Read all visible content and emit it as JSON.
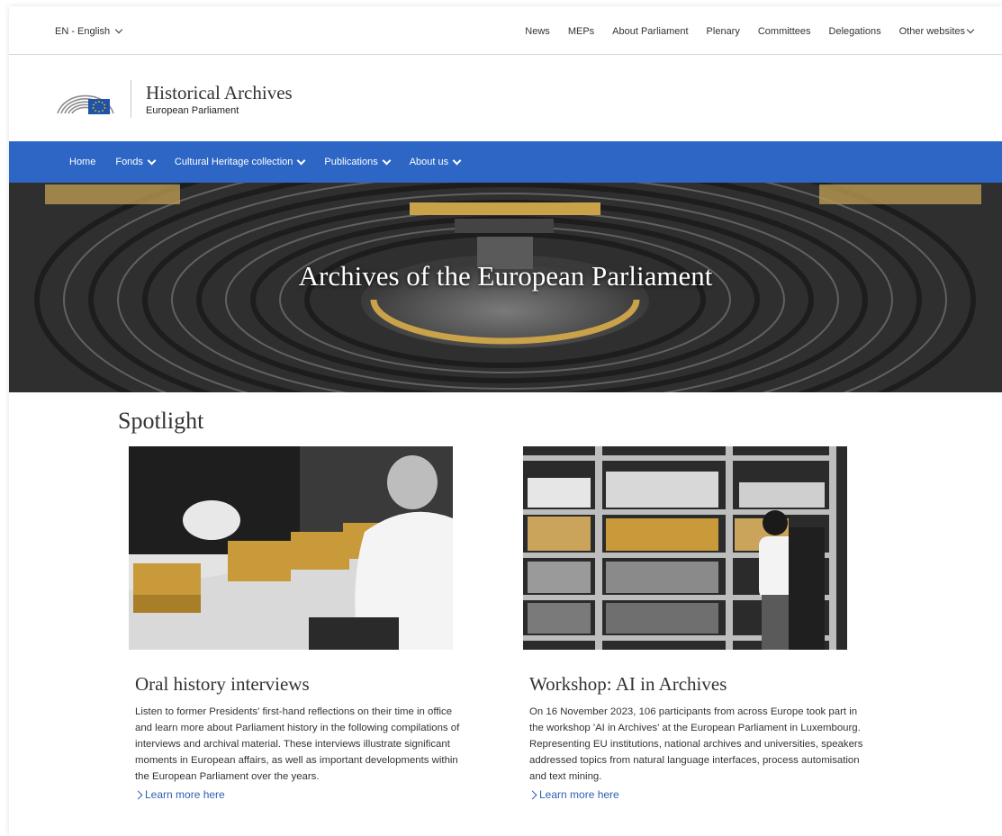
{
  "topbar": {
    "language": "EN - English",
    "links": [
      "News",
      "MEPs",
      "About Parliament",
      "Plenary",
      "Committees",
      "Delegations",
      "Other websites"
    ]
  },
  "brand": {
    "title": "Historical Archives",
    "subtitle": "European Parliament",
    "logo_icon": "eu-parliament-logo-icon"
  },
  "mainnav": {
    "items": [
      {
        "label": "Home",
        "dropdown": false
      },
      {
        "label": "Fonds",
        "dropdown": true
      },
      {
        "label": "Cultural Heritage collection",
        "dropdown": true
      },
      {
        "label": "Publications",
        "dropdown": true
      },
      {
        "label": "About us",
        "dropdown": true
      }
    ],
    "color": "#2d66c4"
  },
  "hero": {
    "title": "Archives of the European Parliament"
  },
  "spotlight": {
    "heading": "Spotlight",
    "cards": [
      {
        "title": "Oral history interviews",
        "body": "Listen to former Presidents' first-hand reflections on their time in office and learn more about Parliament history in the following compilations of interviews and archival material. These interviews illustrate significant moments in European affairs, as well as important developments within the European Parliament over the years.",
        "link": "Learn more here"
      },
      {
        "title": "Workshop: AI in Archives",
        "body": "On 16 November 2023, 106 participants from across Europe took part in the workshop 'AI in Archives' at the European Parliament in Luxembourg. Representing EU institutions, national archives and universities, speakers addressed topics from natural language interfaces, process automisation and text mining.",
        "link": "Learn more here"
      }
    ]
  },
  "colors": {
    "accent_blue": "#2d66c4",
    "link_blue": "#2d5fb3",
    "highlight_yellow": "#c9a24a"
  }
}
